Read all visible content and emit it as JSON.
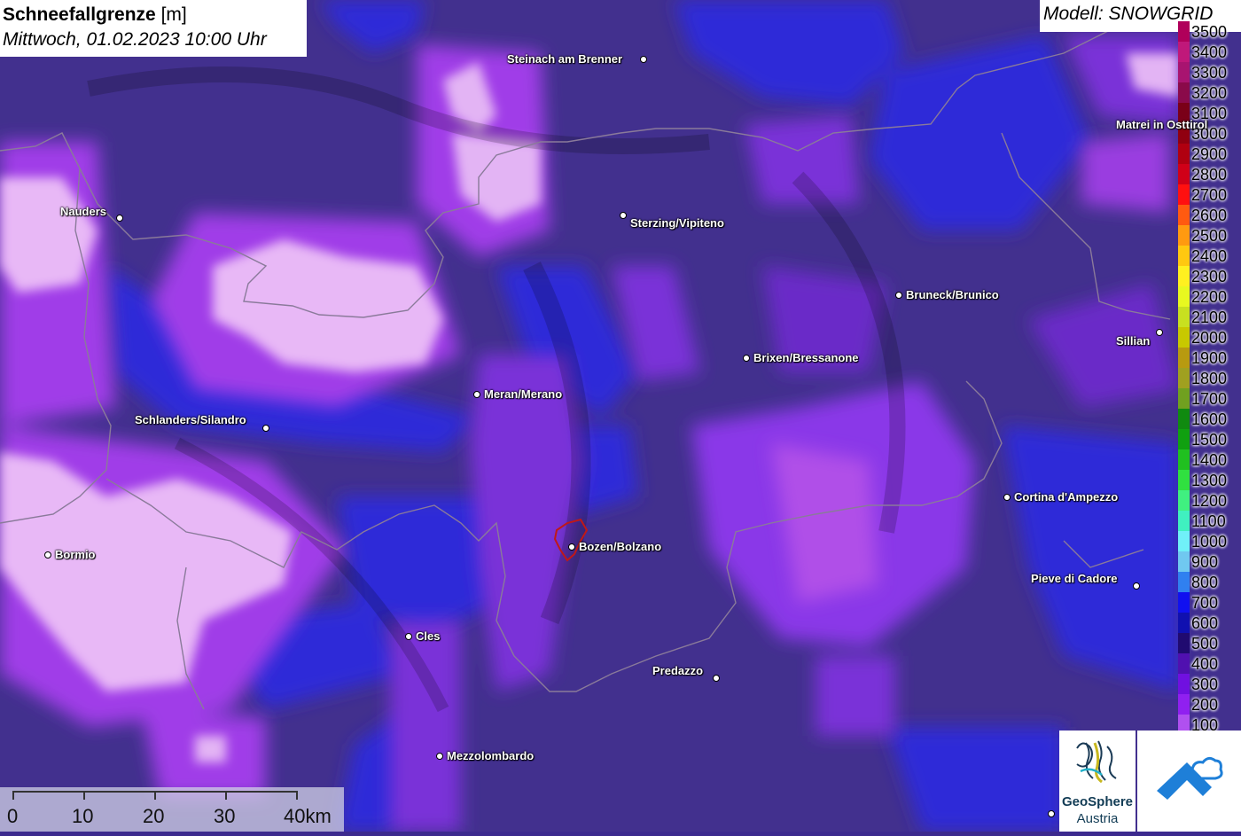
{
  "title": {
    "param": "Schneefallgrenze",
    "unit": "[m]",
    "datetime": "Mittwoch, 01.02.2023 10:00 Uhr"
  },
  "model_label": "Modell: SNOWGRID",
  "legend": {
    "items": [
      {
        "label": "3500",
        "color": "#b0005a"
      },
      {
        "label": "3400",
        "color": "#c0187a"
      },
      {
        "label": "3300",
        "color": "#a81470"
      },
      {
        "label": "3200",
        "color": "#8a0a4a"
      },
      {
        "label": "3100",
        "color": "#7a0018"
      },
      {
        "label": "3000",
        "color": "#900010"
      },
      {
        "label": "2900",
        "color": "#b00010"
      },
      {
        "label": "2800",
        "color": "#d00018"
      },
      {
        "label": "2700",
        "color": "#ff1010"
      },
      {
        "label": "2600",
        "color": "#ff5a10"
      },
      {
        "label": "2500",
        "color": "#ff9a10"
      },
      {
        "label": "2400",
        "color": "#ffc810"
      },
      {
        "label": "2300",
        "color": "#fff020"
      },
      {
        "label": "2200",
        "color": "#e8f820"
      },
      {
        "label": "2100",
        "color": "#c8e020"
      },
      {
        "label": "2000",
        "color": "#c8c800"
      },
      {
        "label": "1900",
        "color": "#b89a10"
      },
      {
        "label": "1800",
        "color": "#a0a020"
      },
      {
        "label": "1700",
        "color": "#70a020"
      },
      {
        "label": "1600",
        "color": "#108a10"
      },
      {
        "label": "1500",
        "color": "#10a010"
      },
      {
        "label": "1400",
        "color": "#20c020"
      },
      {
        "label": "1300",
        "color": "#30e040"
      },
      {
        "label": "1200",
        "color": "#40f080"
      },
      {
        "label": "1100",
        "color": "#40f0c0"
      },
      {
        "label": "1000",
        "color": "#70f0f8"
      },
      {
        "label": "900",
        "color": "#70c8f0"
      },
      {
        "label": "800",
        "color": "#3080f0"
      },
      {
        "label": "700",
        "color": "#1010f0"
      },
      {
        "label": "600",
        "color": "#1010b0"
      },
      {
        "label": "500",
        "color": "#200a70"
      },
      {
        "label": "400",
        "color": "#5010b0"
      },
      {
        "label": "300",
        "color": "#7010e0"
      },
      {
        "label": "200",
        "color": "#9020f0"
      },
      {
        "label": "100",
        "color": "#b050f0"
      }
    ]
  },
  "scale_bar": {
    "labels": [
      "0",
      "10",
      "20",
      "30",
      "40km"
    ]
  },
  "cities": [
    {
      "name": "Steinach am Brenner"
    },
    {
      "name": "Nauders"
    },
    {
      "name": "Sterzing/Vipiteno"
    },
    {
      "name": "Matrei in Osttirol"
    },
    {
      "name": "Bruneck/Brunico"
    },
    {
      "name": "Sillian"
    },
    {
      "name": "Brixen/Bressanone"
    },
    {
      "name": "Meran/Merano"
    },
    {
      "name": "Schlanders/Silandro"
    },
    {
      "name": "Cortina d'Ampezzo"
    },
    {
      "name": "Bormio"
    },
    {
      "name": "Bozen/Bolzano"
    },
    {
      "name": "Pieve di Cadore"
    },
    {
      "name": "Cles"
    },
    {
      "name": "Predazzo"
    },
    {
      "name": "Mezzolombardo"
    }
  ],
  "logos": {
    "geosphere_line1": "GeoSphere",
    "geosphere_line2": "Austria"
  }
}
